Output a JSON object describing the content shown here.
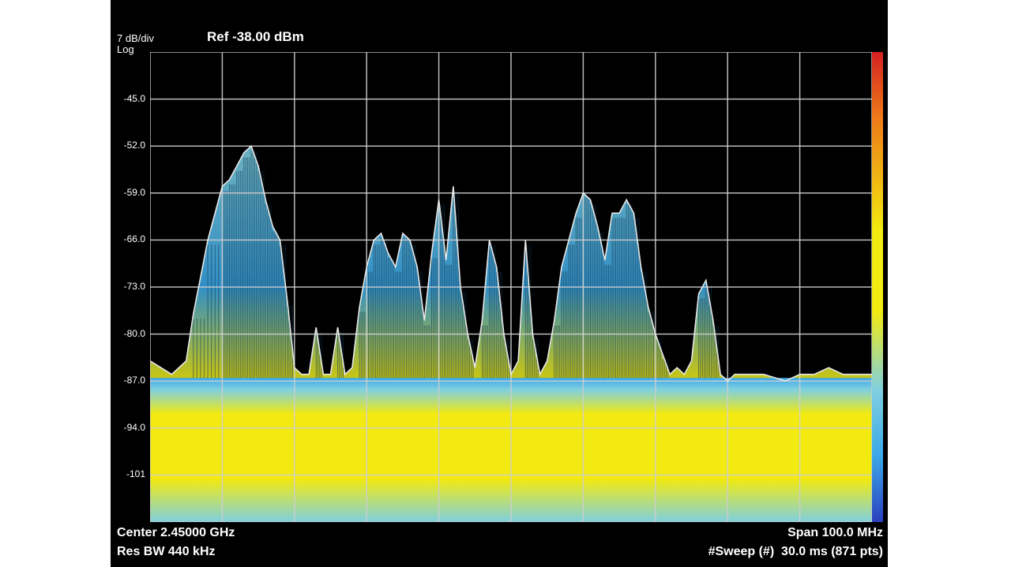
{
  "header": {
    "scale": "7 dB/div",
    "ref": "Ref -38.00 dBm",
    "mode": "Log"
  },
  "footer": {
    "center": "Center 2.45000 GHz",
    "span": "Span 100.0 MHz",
    "res_bw": "Res BW 440 kHz",
    "sweep": "#Sweep (#)  30.0 ms (871 pts)"
  },
  "colors": {
    "background": "#000000",
    "grid": "#cfcfcf",
    "trace": "#e8e8e8",
    "density_low": "#3aa8e8",
    "density_mid": "#7fd0e0",
    "density_high": "#f2ea10",
    "colorbar_top": "#d42020",
    "colorbar_bottom": "#2a3fbf"
  },
  "chart_data": {
    "type": "area",
    "title": "",
    "xlabel": "",
    "ylabel": "",
    "ylim": [
      -108,
      -38
    ],
    "yticks": [
      "-45.0",
      "-52.0",
      "-59.0",
      "-66.0",
      "-73.0",
      "-80.0",
      "-87.0",
      "-94.0",
      "-101"
    ],
    "ytick_values": [
      -45,
      -52,
      -59,
      -66,
      -73,
      -80,
      -87,
      -94,
      -101
    ],
    "xlim": [
      2400,
      2500
    ],
    "x_divisions": 10,
    "grid": true,
    "noise_floor": -87,
    "series": [
      {
        "x": [
          2400,
          2403,
          2405,
          2406,
          2408,
          2410,
          2411,
          2412,
          2413,
          2414,
          2415,
          2416,
          2417,
          2418,
          2419,
          2420,
          2421,
          2422,
          2423,
          2424,
          2425,
          2426,
          2427,
          2428,
          2429,
          2430,
          2431,
          2432,
          2433,
          2434,
          2435,
          2436,
          2437,
          2438,
          2439,
          2440,
          2441,
          2442,
          2443,
          2444,
          2445,
          2446,
          2447,
          2448,
          2449,
          2450,
          2451,
          2452,
          2453,
          2454,
          2455,
          2456,
          2457,
          2458,
          2459,
          2460,
          2461,
          2462,
          2463,
          2464,
          2465,
          2466,
          2467,
          2468,
          2469,
          2470,
          2471,
          2472,
          2473,
          2474,
          2475,
          2476,
          2477,
          2478,
          2479,
          2480,
          2481,
          2482,
          2483,
          2485,
          2488,
          2490,
          2492,
          2494,
          2496,
          2498,
          2500
        ],
        "values": [
          -84,
          -86,
          -84,
          -77,
          -66,
          -58,
          -57,
          -55,
          -53,
          -52,
          -55,
          -60,
          -64,
          -66,
          -75,
          -85,
          -86,
          -86,
          -79,
          -86,
          -86,
          -79,
          -86,
          -85,
          -76,
          -70,
          -66,
          -65,
          -68,
          -70,
          -65,
          -66,
          -70,
          -78,
          -68,
          -60,
          -69,
          -58,
          -73,
          -80,
          -85,
          -78,
          -66,
          -70,
          -80,
          -86,
          -84,
          -66,
          -80,
          -86,
          -84,
          -78,
          -70,
          -66,
          -62,
          -59,
          -60,
          -64,
          -69,
          -62,
          -62,
          -60,
          -62,
          -70,
          -76,
          -80,
          -83,
          -86,
          -85,
          -86,
          -84,
          -74,
          -72,
          -78,
          -86,
          -87,
          -86,
          -86,
          -86,
          -86,
          -87,
          -86,
          -86,
          -85,
          -86,
          -86,
          -86
        ]
      }
    ]
  }
}
